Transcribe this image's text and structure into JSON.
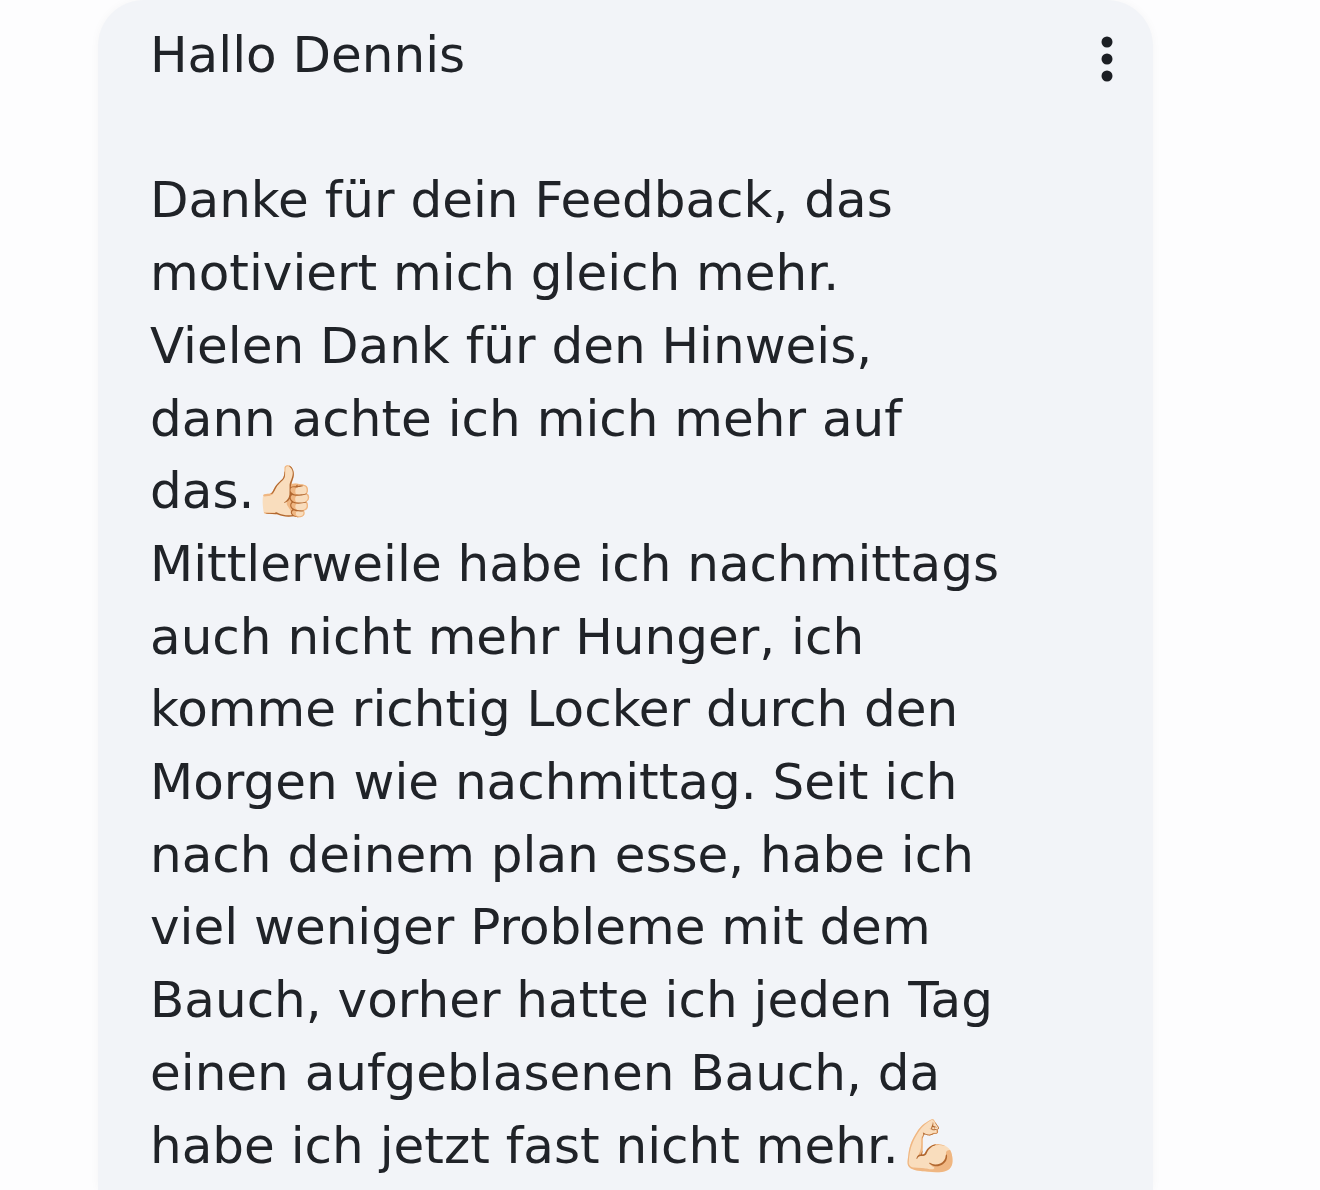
{
  "message": {
    "greeting": "Hallo Dennis",
    "paragraphs": [
      "Danke für dein Feedback, das\nmotiviert mich gleich mehr.",
      "Vielen Dank für den Hinweis,\ndann achte ich mich mehr auf\ndas.👍🏻",
      "Mittlerweile habe ich nachmittags\nauch nicht mehr Hunger, ich\nkomme richtig Locker durch den\nMorgen wie nachmittag. Seit ich\nnach deinem plan esse, habe ich\nviel weniger Probleme mit dem\nBauch, vorher hatte ich jeden Tag\neinen aufgeblasenen Bauch, da\nhabe ich jetzt fast nicht mehr.💪🏻"
    ]
  }
}
